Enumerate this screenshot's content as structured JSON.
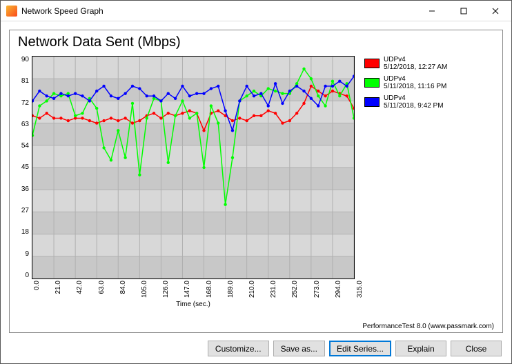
{
  "window": {
    "title": "Network Speed Graph"
  },
  "chart": {
    "title": "Network Data Sent (Mbps)",
    "xlabel": "Time (sec.)",
    "credit": "PerformanceTest 8.0 (www.passmark.com)"
  },
  "yticks": [
    "90",
    "81",
    "72",
    "63",
    "54",
    "45",
    "36",
    "27",
    "18",
    "9",
    "0"
  ],
  "xticks": [
    "0.0",
    "21.0",
    "42.0",
    "63.0",
    "84.0",
    "105.0",
    "126.0",
    "147.0",
    "168.0",
    "189.0",
    "210.0",
    "231.0",
    "252.0",
    "273.0",
    "294.0",
    "315.0"
  ],
  "legend": [
    {
      "color": "#ff0000",
      "name": "UDPv4",
      "sub": "5/12/2018, 12:27 AM"
    },
    {
      "color": "#00ff00",
      "name": "UDPv4",
      "sub": "5/11/2018, 11:16 PM"
    },
    {
      "color": "#0000ff",
      "name": "UDPv4",
      "sub": "5/11/2018, 9:42 PM"
    }
  ],
  "buttons": {
    "customize": "Customize...",
    "saveas": "Save as...",
    "editseries": "Edit Series...",
    "explain": "Explain",
    "close": "Close"
  },
  "chart_data": {
    "type": "line",
    "xlabel": "Time (sec.)",
    "ylabel": "Mbps",
    "title": "Network Data Sent (Mbps)",
    "xlim": [
      0,
      315
    ],
    "ylim": [
      0,
      90
    ],
    "x": [
      0,
      7,
      14,
      21,
      28,
      35,
      42,
      49,
      56,
      63,
      70,
      77,
      84,
      91,
      98,
      105,
      112,
      119,
      126,
      133,
      140,
      147,
      154,
      161,
      168,
      175,
      182,
      189,
      196,
      203,
      210,
      217,
      224,
      231,
      238,
      245,
      252,
      259,
      266,
      273,
      280,
      287,
      294,
      301,
      308,
      315
    ],
    "series": [
      {
        "name": "UDPv4 5/12/2018, 12:27 AM",
        "color": "#ff0000",
        "values": [
          66,
          65,
          67,
          65,
          65,
          64,
          65,
          65,
          64,
          63,
          64,
          65,
          64,
          65,
          63,
          64,
          66,
          67,
          65,
          67,
          66,
          67,
          68,
          67,
          60,
          67,
          68,
          66,
          64,
          65,
          64,
          66,
          66,
          68,
          67,
          63,
          64,
          67,
          71,
          78,
          76,
          74,
          76,
          75,
          74,
          69
        ]
      },
      {
        "name": "UDPv4 5/11/2018, 11:16 PM",
        "color": "#00ff00",
        "values": [
          58,
          70,
          72,
          75,
          74,
          75,
          66,
          67,
          73,
          69,
          53,
          48,
          60,
          49,
          71,
          42,
          65,
          73,
          72,
          47,
          66,
          72,
          65,
          67,
          45,
          70,
          63,
          30,
          49,
          72,
          74,
          76,
          74,
          77,
          76,
          75,
          75,
          79,
          85,
          81,
          74,
          70,
          80,
          74,
          79,
          65
        ]
      },
      {
        "name": "UDPv4 5/11/2018, 9:42 PM",
        "color": "#0000ff",
        "values": [
          72,
          76,
          74,
          73,
          75,
          74,
          75,
          74,
          72,
          76,
          78,
          74,
          73,
          75,
          78,
          77,
          74,
          74,
          72,
          75,
          73,
          78,
          74,
          75,
          75,
          77,
          78,
          68,
          60,
          72,
          78,
          74,
          75,
          70,
          79,
          71,
          76,
          78,
          76,
          73,
          70,
          78,
          78,
          80,
          78,
          82
        ]
      }
    ]
  }
}
